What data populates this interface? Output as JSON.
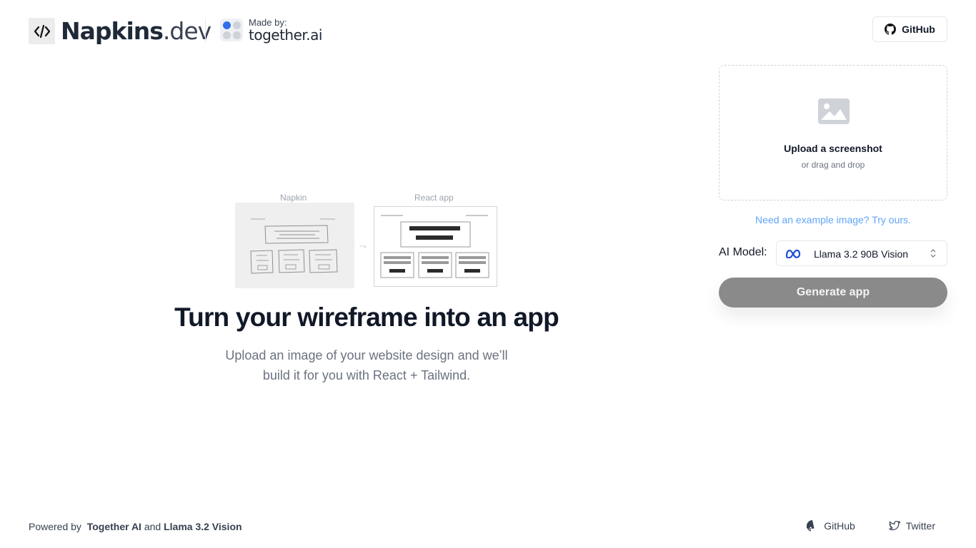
{
  "header": {
    "logo_strong": "Napkins",
    "logo_light": ".dev",
    "made_by_label": "Made by:",
    "made_by_brand": "together.ai",
    "github_label": "GitHub"
  },
  "illustration": {
    "napkin_label": "Napkin",
    "react_label": "React app"
  },
  "hero": {
    "title": "Turn your wireframe into an app",
    "subtitle_line1": "Upload an image of your website design and we’ll",
    "subtitle_line2": "build it for you with React + Tailwind."
  },
  "upload": {
    "title": "Upload a screenshot",
    "subtitle": "or drag and drop"
  },
  "example_link": "Need an example image? Try ours.",
  "model": {
    "label": "AI Model:",
    "selected": "Llama 3.2 90B Vision"
  },
  "generate_label": "Generate app",
  "footer": {
    "powered_by": "Powered by",
    "together": "Together AI",
    "and": "and",
    "llama": "Llama 3.2 Vision",
    "github": "GitHub",
    "twitter": "Twitter"
  },
  "colors": {
    "accent_link": "#60a5fa",
    "generate_button": "#8a8a8a",
    "meta_blue": "#1d4ed8",
    "together_dot": "#2f6fed"
  },
  "icons": [
    "code-icon",
    "github-icon",
    "image-placeholder-icon",
    "meta-icon",
    "chevron-updown-icon",
    "twitter-icon"
  ]
}
